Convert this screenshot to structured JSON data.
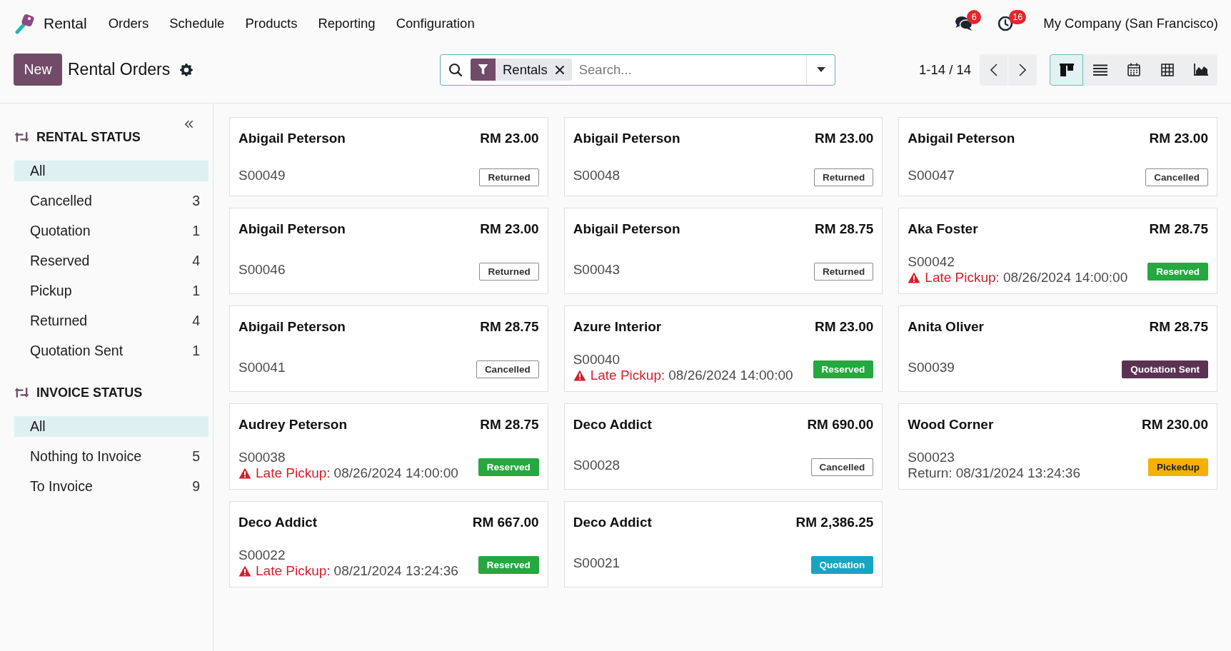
{
  "app": {
    "name": "Rental"
  },
  "menu": [
    {
      "label": "Orders"
    },
    {
      "label": "Schedule"
    },
    {
      "label": "Products"
    },
    {
      "label": "Reporting"
    },
    {
      "label": "Configuration"
    }
  ],
  "systray": {
    "messages_count": "6",
    "activities_count": "16",
    "company": "My Company (San Francisco)"
  },
  "control_panel": {
    "new_button": "New",
    "title": "Rental Orders",
    "search": {
      "facets": [
        {
          "label": "Rentals"
        }
      ],
      "placeholder": "Search..."
    },
    "pager": "1-14 / 14",
    "views": [
      {
        "kind": "kanban",
        "selected": true
      },
      {
        "kind": "list",
        "selected": false
      },
      {
        "kind": "calendar",
        "selected": false
      },
      {
        "kind": "pivot",
        "selected": false
      },
      {
        "kind": "graph",
        "selected": false
      }
    ]
  },
  "sidebar": {
    "sections": [
      {
        "title": "RENTAL STATUS",
        "items": [
          {
            "label": "All",
            "selected": true
          },
          {
            "label": "Cancelled",
            "count": "3",
            "selected": false
          },
          {
            "label": "Quotation",
            "count": "1",
            "selected": false
          },
          {
            "label": "Reserved",
            "count": "4",
            "selected": false
          },
          {
            "label": "Pickup",
            "count": "1",
            "selected": false
          },
          {
            "label": "Returned",
            "count": "4",
            "selected": false
          },
          {
            "label": "Quotation Sent",
            "count": "1",
            "selected": false
          }
        ]
      },
      {
        "title": "INVOICE STATUS",
        "items": [
          {
            "label": "All",
            "selected": true
          },
          {
            "label": "Nothing to Invoice",
            "count": "5",
            "selected": false
          },
          {
            "label": "To Invoice",
            "count": "9",
            "selected": false
          }
        ]
      }
    ]
  },
  "cards": [
    {
      "customer": "Abigail Peterson",
      "amount": "RM 23.00",
      "reference": "S00049",
      "status": {
        "label": "Returned",
        "kind": "outline"
      }
    },
    {
      "customer": "Abigail Peterson",
      "amount": "RM 23.00",
      "reference": "S00048",
      "status": {
        "label": "Returned",
        "kind": "outline"
      }
    },
    {
      "customer": "Abigail Peterson",
      "amount": "RM 23.00",
      "reference": "S00047",
      "status": {
        "label": "Cancelled",
        "kind": "outline"
      }
    },
    {
      "customer": "Abigail Peterson",
      "amount": "RM 23.00",
      "reference": "S00046",
      "status": {
        "label": "Returned",
        "kind": "outline"
      }
    },
    {
      "customer": "Abigail Peterson",
      "amount": "RM 28.75",
      "reference": "S00043",
      "status": {
        "label": "Returned",
        "kind": "outline"
      }
    },
    {
      "customer": "Aka Foster",
      "amount": "RM 28.75",
      "reference": "S00042",
      "schedule": {
        "kind": "late",
        "label": "Late Pickup:",
        "date": "08/26/2024 14:00:00"
      },
      "status": {
        "label": "Reserved",
        "kind": "success"
      }
    },
    {
      "customer": "Abigail Peterson",
      "amount": "RM 28.75",
      "reference": "S00041",
      "status": {
        "label": "Cancelled",
        "kind": "outline"
      }
    },
    {
      "customer": "Azure Interior",
      "amount": "RM 23.00",
      "reference": "S00040",
      "schedule": {
        "kind": "late",
        "label": "Late Pickup:",
        "date": "08/26/2024 14:00:00"
      },
      "status": {
        "label": "Reserved",
        "kind": "success"
      }
    },
    {
      "customer": "Anita Oliver",
      "amount": "RM 28.75",
      "reference": "S00039",
      "status": {
        "label": "Quotation Sent",
        "kind": "primary"
      }
    },
    {
      "customer": "Audrey Peterson",
      "amount": "RM 28.75",
      "reference": "S00038",
      "schedule": {
        "kind": "late",
        "label": "Late Pickup:",
        "date": "08/26/2024 14:00:00"
      },
      "status": {
        "label": "Reserved",
        "kind": "success"
      }
    },
    {
      "customer": "Deco Addict",
      "amount": "RM 690.00",
      "reference": "S00028",
      "status": {
        "label": "Cancelled",
        "kind": "outline"
      }
    },
    {
      "customer": "Wood Corner",
      "amount": "RM 230.00",
      "reference": "S00023",
      "schedule": {
        "kind": "return",
        "label": "Return:",
        "date": "08/31/2024 13:24:36"
      },
      "status": {
        "label": "Pickedup",
        "kind": "warning"
      }
    },
    {
      "customer": "Deco Addict",
      "amount": "RM 667.00",
      "reference": "S00022",
      "schedule": {
        "kind": "late",
        "label": "Late Pickup:",
        "date": "08/21/2024 13:24:36"
      },
      "status": {
        "label": "Reserved",
        "kind": "success"
      }
    },
    {
      "customer": "Deco Addict",
      "amount": "RM 2,386.25",
      "reference": "S00021",
      "status": {
        "label": "Quotation",
        "kind": "info"
      }
    }
  ]
}
